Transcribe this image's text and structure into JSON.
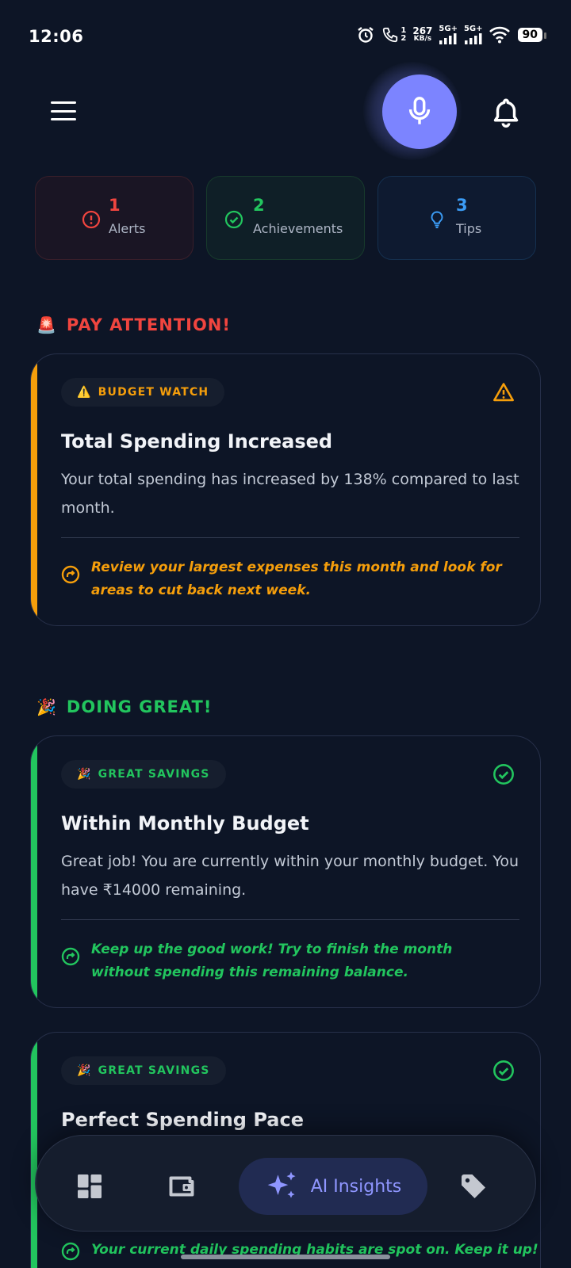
{
  "status_bar": {
    "time": "12:06",
    "call_sim_top": "1",
    "call_sim_bottom": "2",
    "net_speed_value": "267",
    "net_speed_unit": "KB/s",
    "signal_1": "5G+",
    "signal_2": "5G+",
    "battery": "90"
  },
  "header": {
    "menu_icon": "hamburger-menu-icon",
    "mic_icon": "microphone-icon",
    "bell_icon": "bell-icon",
    "accent": "#7c84ff"
  },
  "stats": [
    {
      "count": "1",
      "label": "Alerts",
      "color": "#f0453f",
      "icon": "alert-circle-icon"
    },
    {
      "count": "2",
      "label": "Achievements",
      "color": "#22c55e",
      "icon": "check-circle-icon"
    },
    {
      "count": "3",
      "label": "Tips",
      "color": "#3b9cf5",
      "icon": "lightbulb-icon"
    }
  ],
  "sections": {
    "attention": {
      "emoji": "🚨",
      "title": "PAY ATTENTION!",
      "color": "#f0453f"
    },
    "great": {
      "emoji": "🎉",
      "title": "DOING GREAT!",
      "color": "#22c55e"
    }
  },
  "insights": [
    {
      "tag_emoji": "⚠️",
      "tag": "BUDGET WATCH",
      "title": "Total Spending Increased",
      "description": "Your total spending has increased by 138% compared to last month.",
      "tip": "Review your largest expenses this month and look for areas to cut back next week.",
      "color": "#f59e0b"
    },
    {
      "tag_emoji": "🎉",
      "tag": "GREAT SAVINGS",
      "title": "Within Monthly Budget",
      "description": "Great job! You are currently within your monthly budget. You have ₹14000 remaining.",
      "tip": "Keep up the good work! Try to finish the month without spending this remaining balance.",
      "color": "#22c55e"
    },
    {
      "tag_emoji": "🎉",
      "tag": "GREAT SAVINGS",
      "title": "Perfect Spending Pace",
      "tip": "Your current daily spending habits are spot on. Keep it up!",
      "color": "#22c55e"
    }
  ],
  "bottom_nav": {
    "items": [
      "dashboard-icon",
      "wallet-icon",
      "sparkles-icon",
      "tag-icon"
    ],
    "active_label": "AI Insights",
    "active_color": "#8f96ff"
  }
}
